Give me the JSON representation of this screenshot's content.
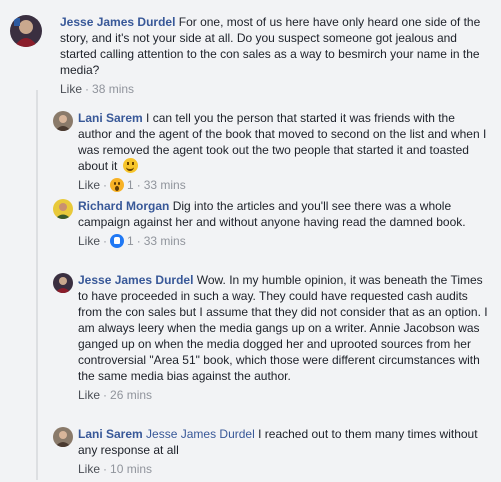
{
  "comments": [
    {
      "author": "Jesse James Durdel",
      "text": "For one, most of us here have only heard one side of the story, and it's not your side at all. Do you suspect someone got jealous and started calling attention to the con sales as a way to besmirch your name in the media?",
      "like_label": "Like",
      "time": "38 mins"
    },
    {
      "author": "Lani Sarem",
      "text": "I can tell you the person that started it was friends with the author and the agent of the book that moved to second on the list and when I was removed the agent took out the two people that started it and toasted about it",
      "emoji": "smiling-face-emoji",
      "like_label": "Like",
      "reaction": "wow",
      "reaction_count": "1",
      "time": "33 mins"
    },
    {
      "author": "Richard Morgan",
      "text": "Dig into the articles and you'll see there was a whole campaign against her and without anyone having read the damned book.",
      "like_label": "Like",
      "reaction": "like",
      "reaction_count": "1",
      "time": "33 mins"
    },
    {
      "author": "Jesse James Durdel",
      "text": "Wow. In my humble opinion, it was beneath the Times to have proceeded in such a way. They could have requested cash audits from the con sales but I assume that they did not consider that as an option. I am always leery when the media gangs up on a writer. Annie Jacobson was ganged up on when the media dogged her and uprooted sources from her controversial \"Area 51\" book, which those were different circumstances with the same media bias against the author.",
      "like_label": "Like",
      "time": "26 mins"
    },
    {
      "author": "Lani Sarem",
      "mention": "Jesse James Durdel",
      "text": "I reached out to them many times without any response at all",
      "like_label": "Like",
      "time": "10 mins"
    }
  ],
  "separator": "·"
}
